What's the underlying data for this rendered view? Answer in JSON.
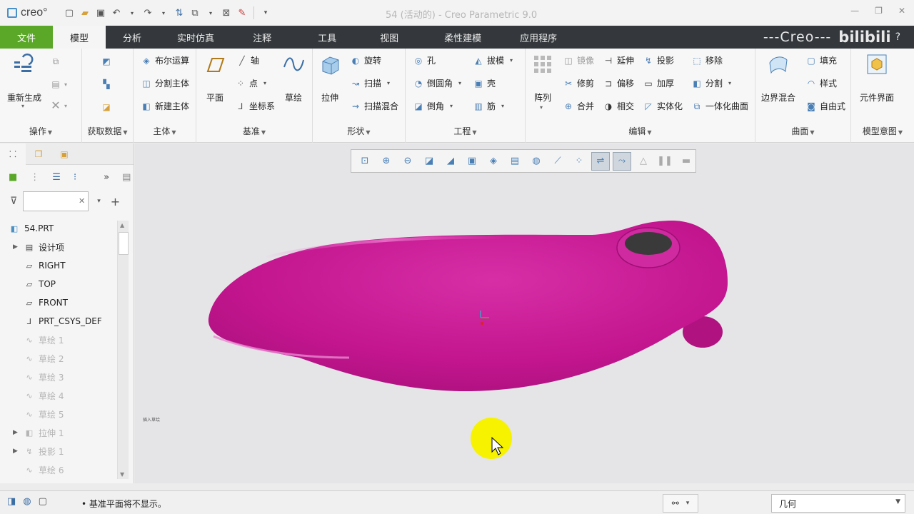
{
  "titlebar": {
    "app_logo_text": "creo°",
    "window_title": "54 (活动的) - Creo Parametric 9.0"
  },
  "tabs": [
    {
      "label": "文件"
    },
    {
      "label": "模型"
    },
    {
      "label": "分析"
    },
    {
      "label": "实时仿真"
    },
    {
      "label": "注释"
    },
    {
      "label": "工具"
    },
    {
      "label": "视图"
    },
    {
      "label": "柔性建模"
    },
    {
      "label": "应用程序"
    }
  ],
  "brand_text": "---Creo---",
  "brand_logo": "bilibili",
  "ribbon": {
    "operations": {
      "label": "操作",
      "regen": "重新生成"
    },
    "getdata": {
      "label": "获取数据"
    },
    "body": {
      "label": "主体",
      "boolean": "布尔运算",
      "split_body": "分割主体",
      "new_body": "新建主体"
    },
    "datum": {
      "label": "基准",
      "plane": "平面",
      "axis": "轴",
      "point": "点",
      "csys": "坐标系",
      "sketch": "草绘"
    },
    "shapes": {
      "label": "形状",
      "extrude": "拉伸",
      "revolve": "旋转",
      "sweep": "扫描",
      "swept_blend": "扫描混合"
    },
    "engineering": {
      "label": "工程",
      "hole": "孔",
      "round": "倒圆角",
      "chamfer": "倒角",
      "draft": "拔模",
      "shell": "壳",
      "rib": "筋"
    },
    "editing": {
      "label": "编辑",
      "pattern": "阵列",
      "mirror": "镜像",
      "trim": "修剪",
      "merge": "合并",
      "extend": "延伸",
      "offset": "偏移",
      "intersect": "相交",
      "project": "投影",
      "thicken": "加厚",
      "solidify": "实体化",
      "remove": "移除",
      "split": "分割",
      "unify": "一体化曲面"
    },
    "surfaces": {
      "label": "曲面",
      "boundary_blend": "边界混合",
      "fill": "填充",
      "style": "样式",
      "freestyle": "自由式"
    },
    "model_intent": {
      "label": "模型意图",
      "component_interface": "元件界面"
    }
  },
  "model_tree": {
    "filter_placeholder": "",
    "items": [
      {
        "label": "54.PRT"
      },
      {
        "label": "设计项"
      },
      {
        "label": "RIGHT"
      },
      {
        "label": "TOP"
      },
      {
        "label": "FRONT"
      },
      {
        "label": "PRT_CSYS_DEF"
      },
      {
        "label": "草绘 1"
      },
      {
        "label": "草绘 2"
      },
      {
        "label": "草绘 3"
      },
      {
        "label": "草绘 4"
      },
      {
        "label": "草绘 5"
      },
      {
        "label": "拉伸 1"
      },
      {
        "label": "投影 1"
      },
      {
        "label": "草绘 6"
      }
    ]
  },
  "viewport": {
    "model_color": "#c2158e",
    "hint": "插入草绘"
  },
  "statusbar": {
    "message": "• 基准平面将不显示。",
    "filter_value": "几何"
  }
}
